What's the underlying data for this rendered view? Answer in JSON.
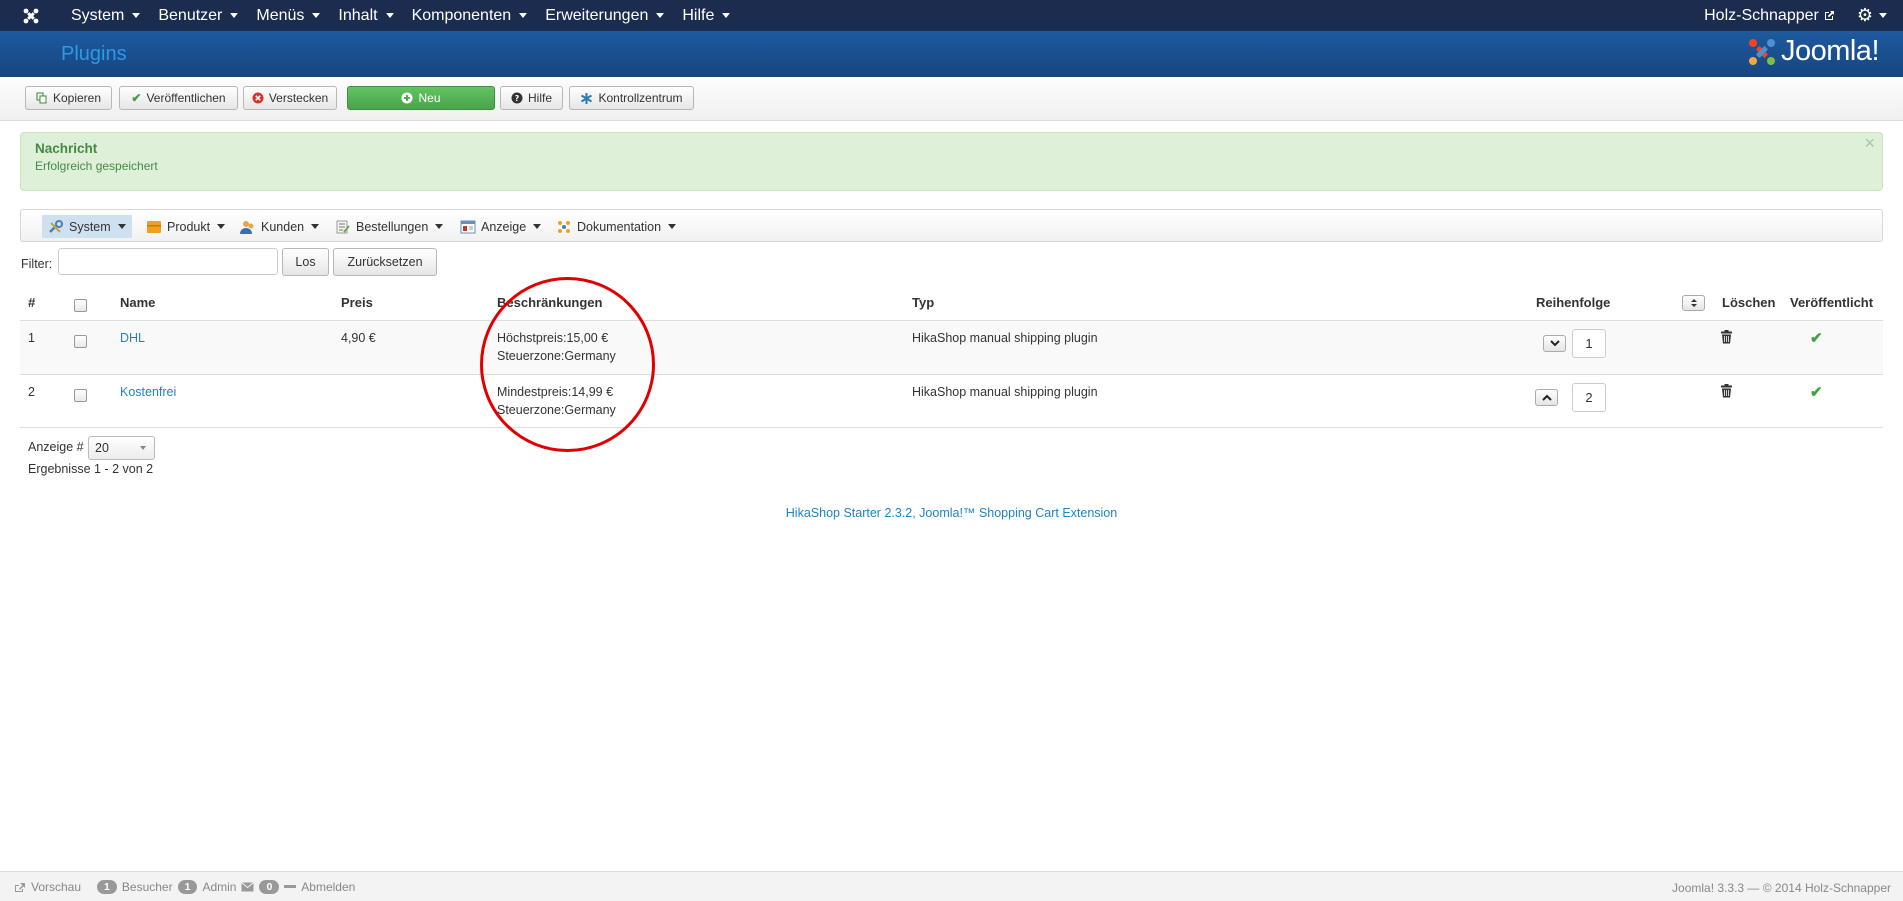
{
  "nav": {
    "menu": [
      "System",
      "Benutzer",
      "Menüs",
      "Inhalt",
      "Komponenten",
      "Erweiterungen",
      "Hilfe"
    ],
    "site_link": "Holz-Schnapper"
  },
  "header": {
    "title": "Plugins",
    "brand": "Joomla!"
  },
  "toolbar": {
    "copy": "Kopieren",
    "publish": "Veröffentlichen",
    "hide": "Verstecken",
    "new": "Neu",
    "help": "Hilfe",
    "control_center": "Kontrollzentrum"
  },
  "alert": {
    "title": "Nachricht",
    "text": "Erfolgreich gespeichert",
    "close": "×"
  },
  "submenu": [
    "System",
    "Produkt",
    "Kunden",
    "Bestellungen",
    "Anzeige",
    "Dokumentation"
  ],
  "filter": {
    "label": "Filter:",
    "value": "",
    "go": "Los",
    "reset": "Zurücksetzen"
  },
  "table": {
    "headers": {
      "num": "#",
      "name": "Name",
      "price": "Preis",
      "restrictions": "Beschränkungen",
      "type": "Typ",
      "order": "Reihenfolge",
      "delete": "Löschen",
      "published": "Veröffentlicht"
    },
    "rows": [
      {
        "num": "1",
        "name": "DHL",
        "price": "4,90 €",
        "restr1": "Höchstpreis:15,00 €",
        "restr2": "Steuerzone:Germany",
        "type": "HikaShop manual shipping plugin",
        "order": "1",
        "published": true
      },
      {
        "num": "2",
        "name": "Kostenfrei",
        "price": "",
        "restr1": "Mindestpreis:14,99 €",
        "restr2": "Steuerzone:Germany",
        "type": "HikaShop manual shipping plugin",
        "order": "2",
        "published": true
      }
    ]
  },
  "pagination": {
    "limit_label": "Anzeige #",
    "limit_value": "20",
    "results": "Ergebnisse 1 - 2 von 2"
  },
  "footer_ext": "HikaShop Starter 2.3.2, Joomla!™ Shopping Cart Extension",
  "status": {
    "preview": "Vorschau",
    "visitors_count": "1",
    "visitors": "Besucher",
    "admin_count": "1",
    "admin": "Admin",
    "messages_count": "0",
    "logout": "Abmelden",
    "version": "Joomla! 3.3.3 — © 2014 Holz-Schnapper"
  },
  "colors": {
    "navbar": "#1b2c4e",
    "header": "#17457e",
    "link": "#1f84c5",
    "success": "#3fa33f",
    "highlight_circle": "#e00000"
  }
}
